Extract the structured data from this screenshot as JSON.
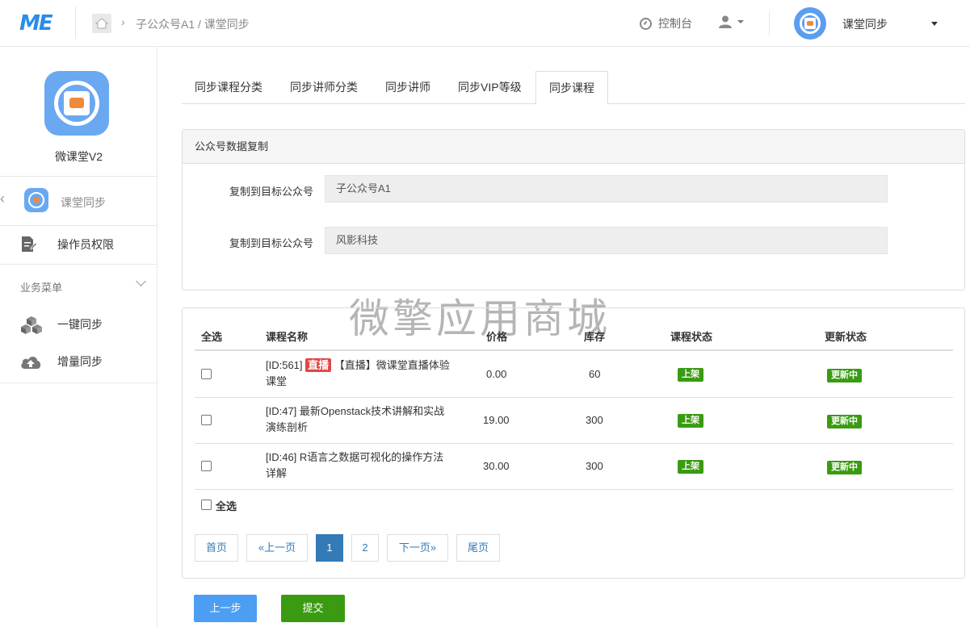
{
  "header": {
    "logo": "ME",
    "breadcrumb": "子公众号A1 / 课堂同步",
    "console": "控制台",
    "app_name": "课堂同步"
  },
  "sidebar": {
    "title": "微课堂V2",
    "current": "课堂同步",
    "items": [
      {
        "label": "操作员权限",
        "icon": "edit-doc-icon"
      }
    ],
    "section": "业务菜单",
    "section_items": [
      {
        "label": "一键同步",
        "icon": "cubes-icon"
      },
      {
        "label": "增量同步",
        "icon": "cloud-upload-icon"
      }
    ]
  },
  "tabs": [
    {
      "label": "同步课程分类"
    },
    {
      "label": "同步讲师分类"
    },
    {
      "label": "同步讲师"
    },
    {
      "label": "同步VIP等级"
    },
    {
      "label": "同步课程",
      "active": true
    }
  ],
  "copy_panel": {
    "title": "公众号数据复制",
    "fields": [
      {
        "label": "复制到目标公众号",
        "value": "子公众号A1"
      },
      {
        "label": "复制到目标公众号",
        "value": "风影科技"
      }
    ]
  },
  "watermark": "微擎应用商城",
  "table": {
    "headers": {
      "select": "全选",
      "name": "课程名称",
      "price": "价格",
      "stock": "库存",
      "status": "课程状态",
      "update": "更新状态"
    },
    "rows": [
      {
        "id": "[ID:561]",
        "badge": "直播",
        "name": "【直播】微课堂直播体验课堂",
        "price": "0.00",
        "stock": "60",
        "status": "上架",
        "update": "更新中"
      },
      {
        "id": "[ID:47]",
        "badge": "",
        "name": "最新Openstack技术讲解和实战演练剖析",
        "price": "19.00",
        "stock": "300",
        "status": "上架",
        "update": "更新中"
      },
      {
        "id": "[ID:46]",
        "badge": "",
        "name": "R语言之数据可视化的操作方法详解",
        "price": "30.00",
        "stock": "300",
        "status": "上架",
        "update": "更新中"
      }
    ],
    "select_all": "全选"
  },
  "pagination": {
    "first": "首页",
    "prev": "«上一页",
    "pages": [
      "1",
      "2"
    ],
    "current": "1",
    "next": "下一页»",
    "last": "尾页"
  },
  "buttons": {
    "prev_step": "上一步",
    "submit": "提交"
  },
  "colors": {
    "primary": "#337ab7",
    "success": "#3a9b12",
    "danger": "#e24545",
    "brand": "#2b8ce6"
  }
}
